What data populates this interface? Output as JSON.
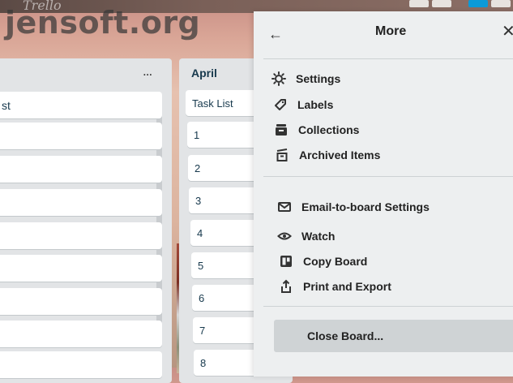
{
  "header": {
    "logo_text": "Trello"
  },
  "watermark": "jensoft.org",
  "list_left": {
    "menu_glyph": "...",
    "cards": [
      "st",
      "",
      "",
      "",
      "",
      "",
      "",
      "",
      ""
    ]
  },
  "list_april": {
    "title": "April",
    "cards": [
      "Task List",
      "1",
      "2",
      "3",
      "4",
      "5",
      "6",
      "7",
      "8"
    ]
  },
  "panel": {
    "title": "More",
    "back_icon": "arrow-left-icon",
    "close_icon": "close-icon",
    "section1": [
      {
        "label": "Settings",
        "icon": "gear-icon"
      },
      {
        "label": "Labels",
        "icon": "tag-icon"
      },
      {
        "label": "Collections",
        "icon": "collections-icon"
      },
      {
        "label": "Archived Items",
        "icon": "archive-icon"
      }
    ],
    "section2": [
      {
        "label": "Email-to-board Settings",
        "icon": "envelope-icon"
      },
      {
        "label": "Watch",
        "icon": "eye-icon"
      },
      {
        "label": "Copy Board",
        "icon": "copy-board-icon"
      },
      {
        "label": "Print and Export",
        "icon": "share-icon"
      }
    ],
    "close_board": "Close Board..."
  }
}
